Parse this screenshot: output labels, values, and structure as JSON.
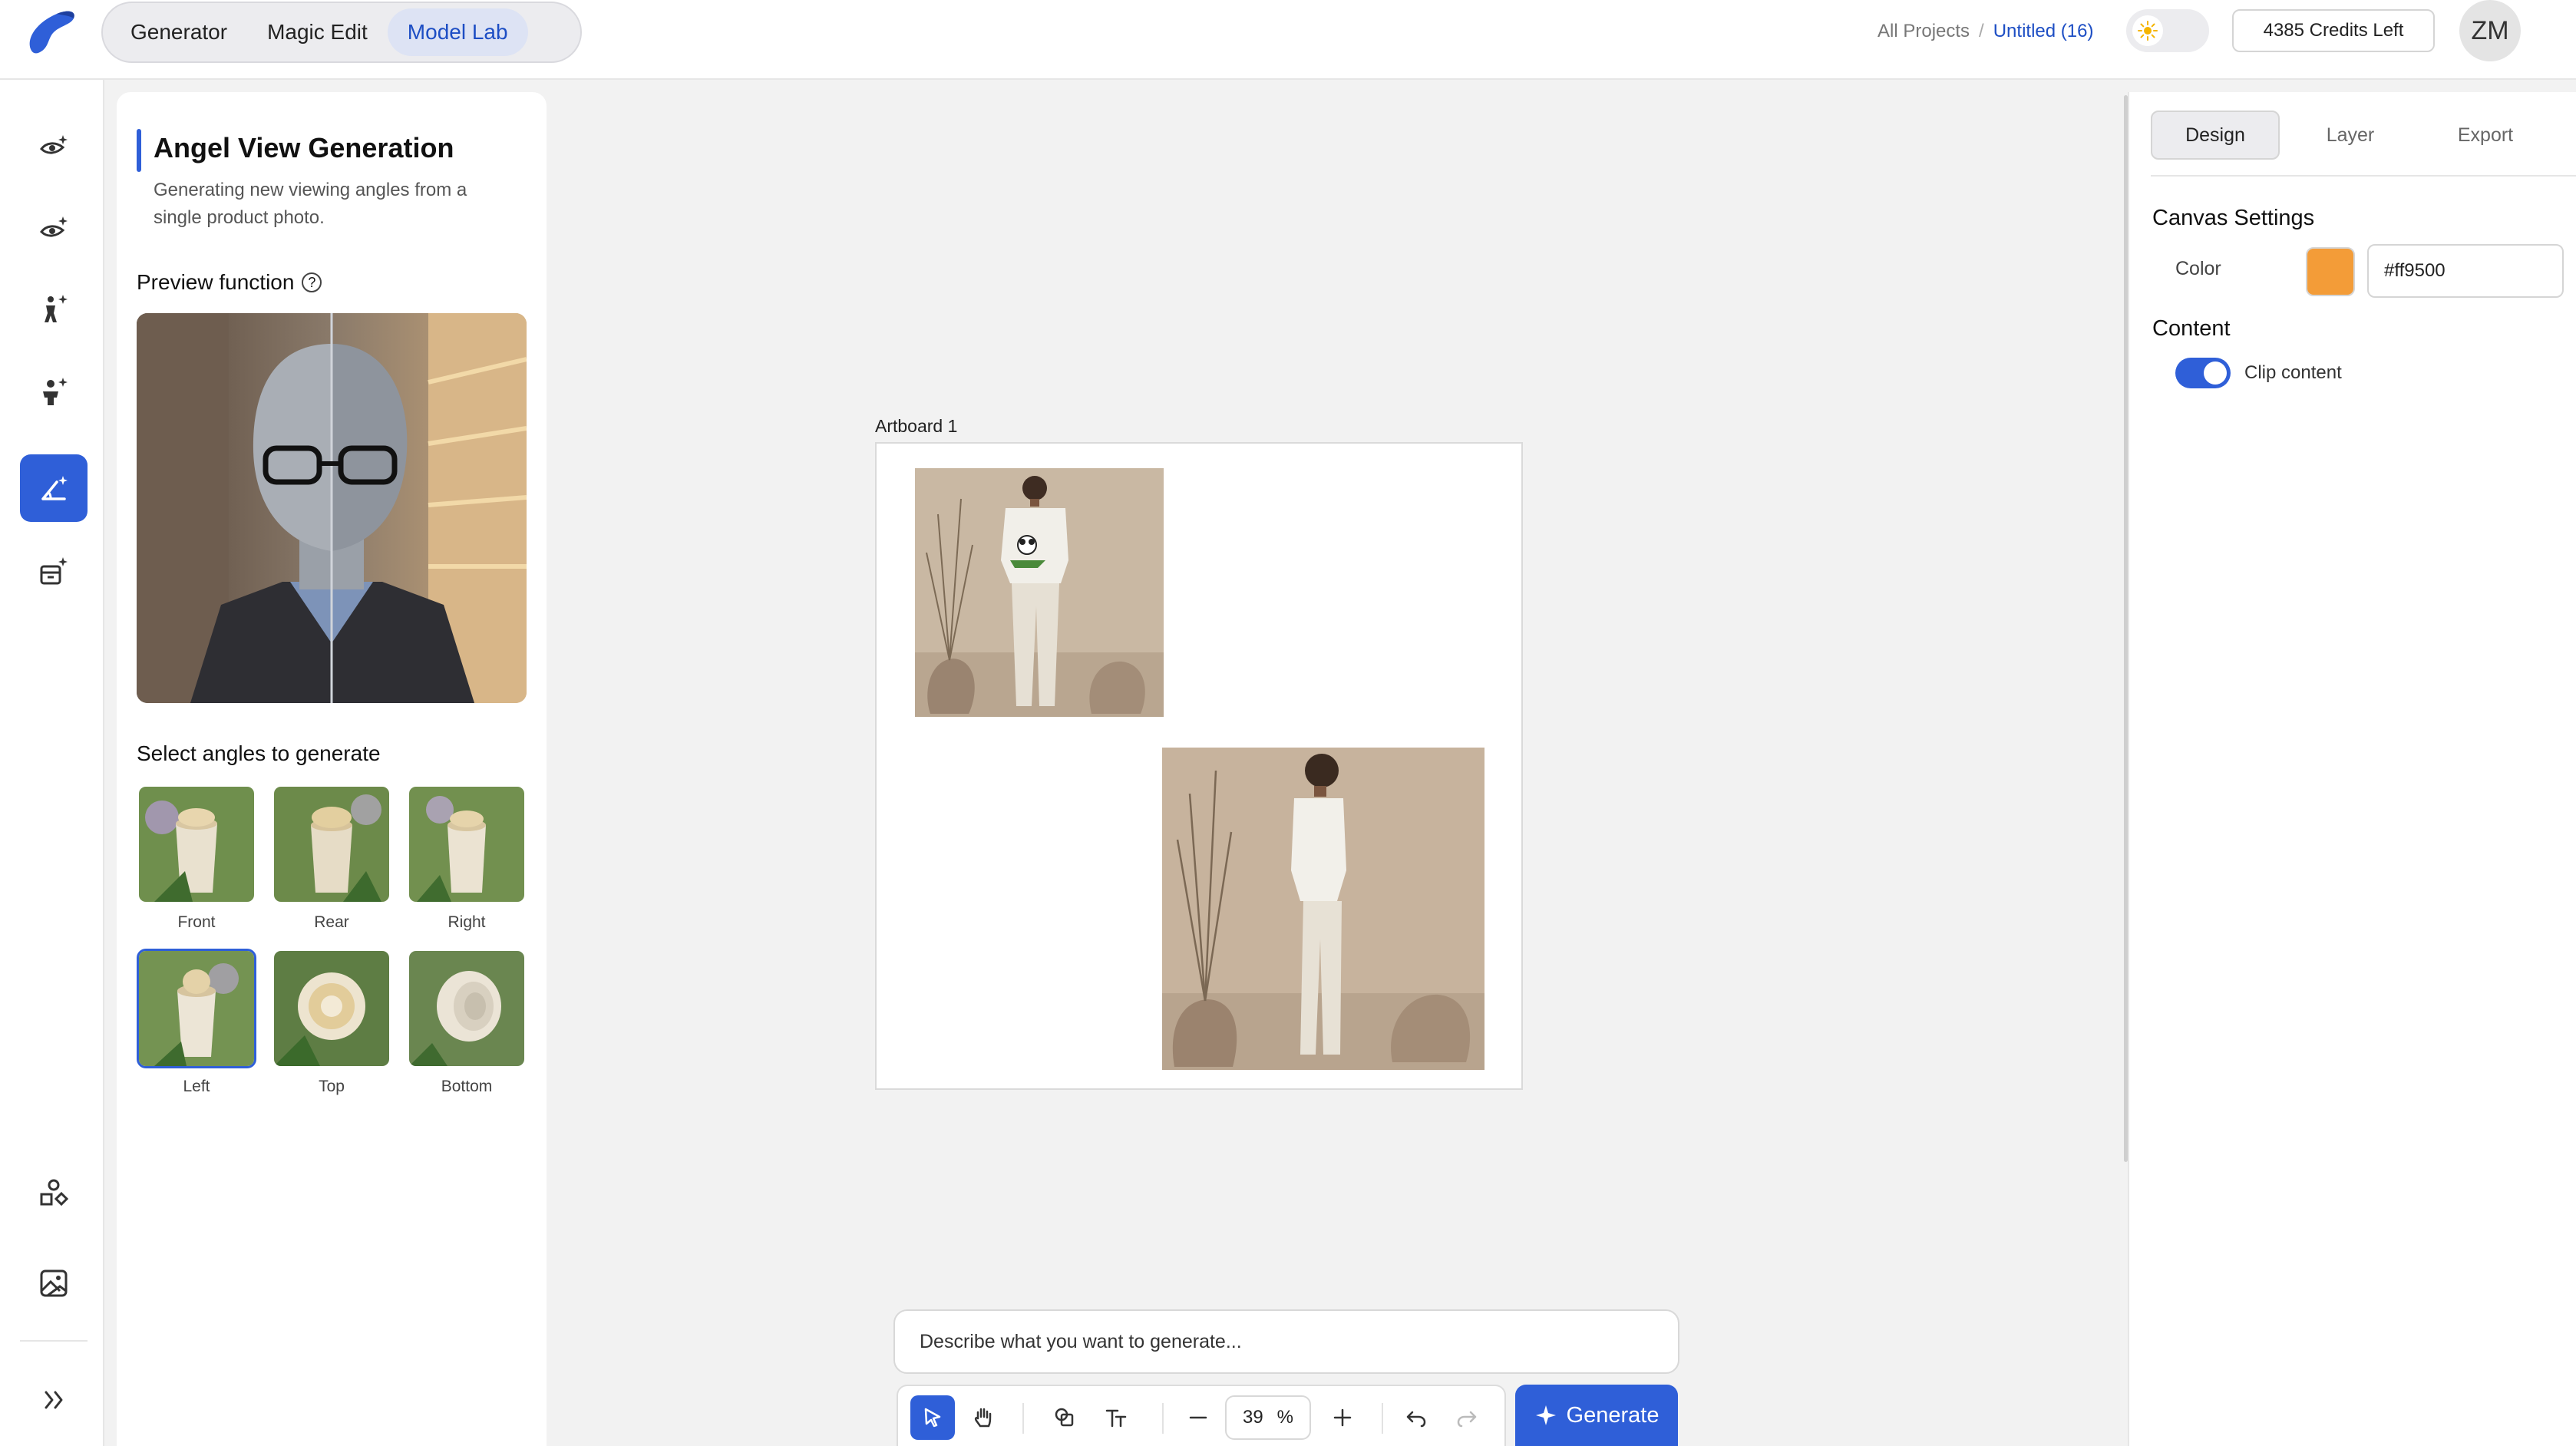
{
  "header": {
    "tabs": [
      {
        "label": "Generator",
        "active": false
      },
      {
        "label": "Magic Edit",
        "active": false
      },
      {
        "label": "Model Lab",
        "active": true
      }
    ],
    "breadcrumb": {
      "root": "All Projects",
      "separator": "/",
      "current": "Untitled (16)"
    },
    "credits": "4385 Credits Left",
    "avatar_initials": "ZM",
    "theme": "light"
  },
  "rail": {
    "items": [
      {
        "icon": "eye-sparkle-icon",
        "active": false
      },
      {
        "icon": "eye-sparkle-icon",
        "active": false
      },
      {
        "icon": "person-sparkle-icon",
        "active": false
      },
      {
        "icon": "model-sparkle-icon",
        "active": false
      },
      {
        "icon": "angle-sparkle-icon",
        "active": true
      },
      {
        "icon": "box-sparkle-icon",
        "active": false
      }
    ],
    "bottom": [
      {
        "icon": "shapes-icon"
      },
      {
        "icon": "image-icon"
      },
      {
        "icon": "expand-icon"
      }
    ]
  },
  "left_panel": {
    "title": "Angel View Generation",
    "description": "Generating new viewing angles from a single product photo.",
    "preview_label": "Preview function",
    "help_glyph": "?",
    "angles_label": "Select angles to generate",
    "angles": [
      {
        "label": "Front",
        "selected": false
      },
      {
        "label": "Rear",
        "selected": false
      },
      {
        "label": "Right",
        "selected": false
      },
      {
        "label": "Left",
        "selected": true
      },
      {
        "label": "Top",
        "selected": false
      },
      {
        "label": "Bottom",
        "selected": false
      }
    ]
  },
  "canvas": {
    "artboard_label": "Artboard 1"
  },
  "right_panel": {
    "tabs": [
      {
        "label": "Design",
        "active": true
      },
      {
        "label": "Layer",
        "active": false
      },
      {
        "label": "Export",
        "active": false
      }
    ],
    "canvas_settings_label": "Canvas Settings",
    "color_label": "Color",
    "color_value": "#ff9500",
    "swatch_color": "#f39c38",
    "content_label": "Content",
    "clip_label": "Clip content",
    "clip_enabled": true
  },
  "bottom": {
    "prompt_placeholder": "Describe what you want to generate...",
    "zoom_value": "39",
    "zoom_unit": "%",
    "generate_label": "Generate"
  },
  "colors": {
    "accent": "#2f5fd8",
    "accent_text": "#1d4ec4"
  }
}
